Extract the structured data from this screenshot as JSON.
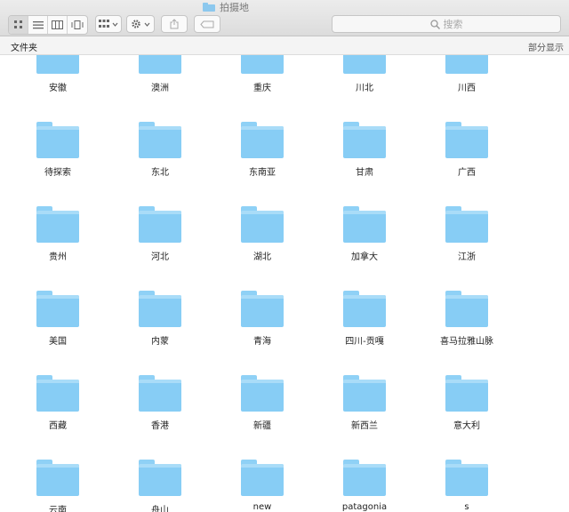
{
  "window": {
    "title": "拍摄地"
  },
  "toolbar": {
    "view_icons": [
      "icon-view-icon",
      "list-view-icon",
      "column-view-icon",
      "coverflow-view-icon"
    ],
    "search_placeholder": "搜索"
  },
  "pathbar": {
    "left": "文件夹",
    "right": "部分显示"
  },
  "folders": [
    "安徽",
    "澳洲",
    "重庆",
    "川北",
    "川西",
    "待探索",
    "东北",
    "东南亚",
    "甘肃",
    "广西",
    "贵州",
    "河北",
    "湖北",
    "加拿大",
    "江浙",
    "美国",
    "内蒙",
    "青海",
    "四川-贡嘎",
    "喜马拉雅山脉",
    "西藏",
    "香港",
    "新疆",
    "新西兰",
    "意大利",
    "云南",
    "舟山",
    "new",
    "patagonia",
    "s"
  ],
  "colors": {
    "folder": "#87cdf5",
    "toolbar": "#e3e3e3"
  }
}
